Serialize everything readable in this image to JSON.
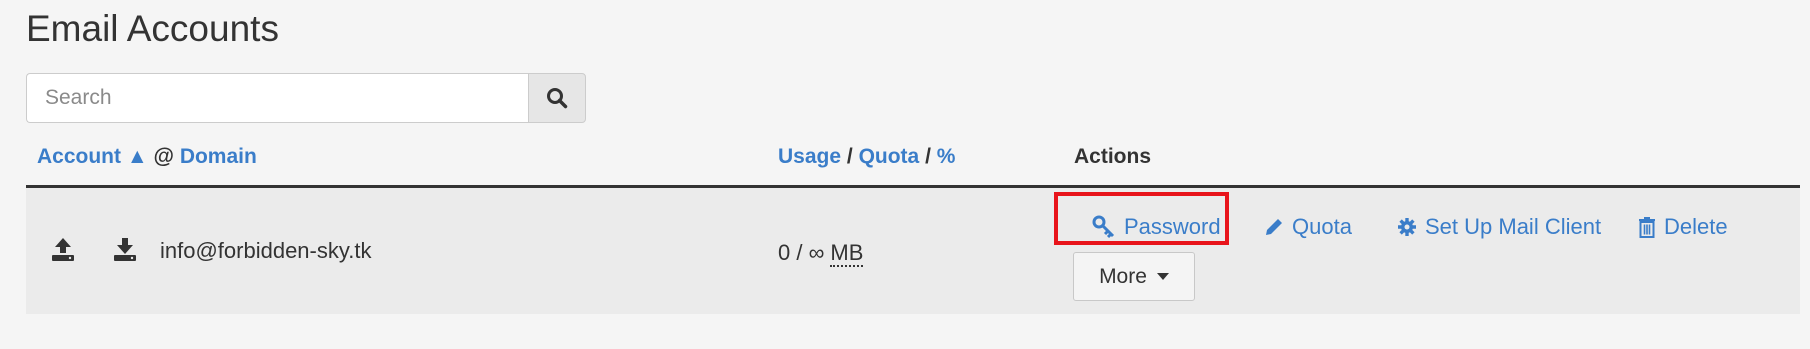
{
  "page": {
    "title": "Email Accounts"
  },
  "search": {
    "placeholder": "Search"
  },
  "table": {
    "headers": {
      "account": "Account",
      "sort_indicator": "▲",
      "at": "@",
      "domain": "Domain",
      "usage": "Usage",
      "slash1": "/",
      "quota": "Quota",
      "slash2": "/",
      "percent": "%",
      "actions": "Actions"
    },
    "rows": [
      {
        "account": "info@forbidden-sky.tk",
        "usage_value": "0 / ∞ ",
        "usage_unit": "MB"
      }
    ]
  },
  "actions": {
    "password": "Password",
    "quota": "Quota",
    "setup": "Set Up Mail Client",
    "delete": "Delete",
    "more": "More"
  },
  "colors": {
    "link": "#3a7dc9",
    "highlight": "#e8141b"
  }
}
